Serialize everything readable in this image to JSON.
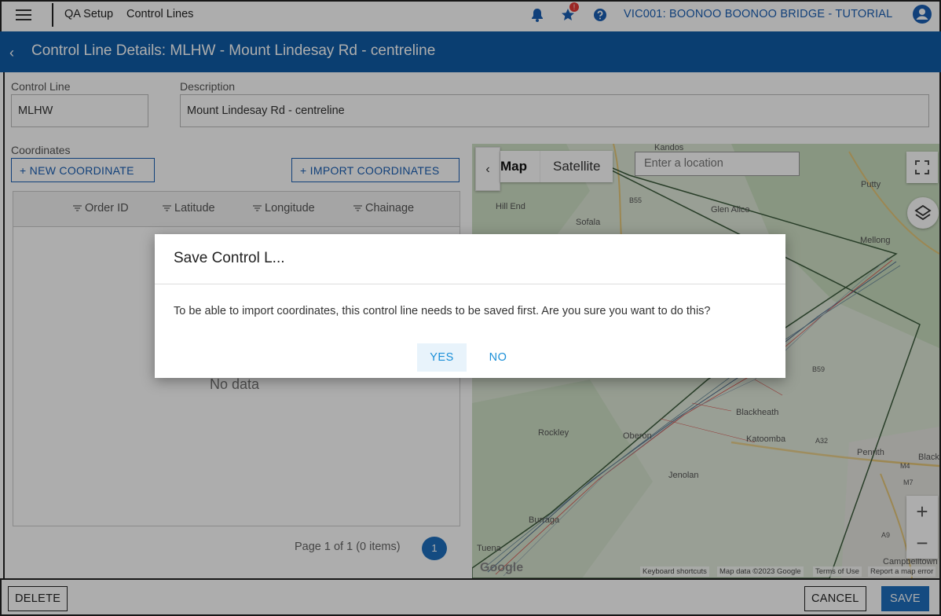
{
  "topbar": {
    "breadcrumb": [
      "QA Setup",
      "Control Lines"
    ],
    "project": "VIC001: BOONOO BOONOO BRIDGE - TUTORIAL",
    "notification_badge": "!"
  },
  "titlebar": {
    "back": "‹",
    "title": "Control Line Details: MLHW - Mount Lindesay Rd - centreline"
  },
  "form": {
    "control_line_label": "Control Line",
    "control_line_value": "MLHW",
    "description_label": "Description",
    "description_value": "Mount Lindesay Rd - centreline"
  },
  "coordinates": {
    "label": "Coordinates",
    "new_button": "+  NEW COORDINATE",
    "import_button": "+  IMPORT COORDINATES",
    "columns": [
      "Order ID",
      "Latitude",
      "Longitude",
      "Chainage"
    ],
    "no_data": "No data",
    "pager": "Page 1 of 1 (0 items)",
    "page_number": "1"
  },
  "map": {
    "collapse": "‹",
    "types": [
      "Map",
      "Satellite"
    ],
    "search_placeholder": "Enter a location",
    "places": [
      "Kandos",
      "Putty",
      "Hill End",
      "Sofala",
      "Glen Alice",
      "Mellong",
      "Blackheath",
      "Rockley",
      "Oberon",
      "Katoomba",
      "Penrith",
      "Black",
      "Jenolan",
      "Burraga",
      "Tuena",
      "Campbelltown"
    ],
    "road_labels": [
      "B55",
      "B59",
      "A32",
      "M4",
      "M7",
      "A9"
    ],
    "logo": "Google",
    "footer": [
      "Keyboard shortcuts",
      "Map data ©2023 Google",
      "Terms of Use",
      "Report a map error"
    ],
    "zoom_in": "+",
    "zoom_out": "−"
  },
  "dialog": {
    "title": "Save Control L...",
    "message": "To be able to import coordinates, this control line needs to be saved first. Are you sure you want to do this?",
    "yes": "YES",
    "no": "NO"
  },
  "bottombar": {
    "delete": "DELETE",
    "cancel": "CANCEL",
    "save": "SAVE"
  },
  "colors": {
    "header_blue": "#105ca7",
    "link_blue": "#1a5fb4",
    "dialog_action": "#1a8fd8"
  }
}
